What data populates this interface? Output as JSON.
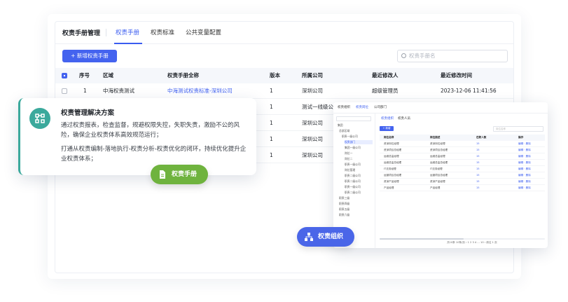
{
  "tabs": {
    "title": "权责手册管理",
    "items": [
      "权责手册",
      "权责标准",
      "公共变量配置"
    ]
  },
  "toolbar": {
    "add_label": "+ 新增权责手册",
    "search_placeholder": "权责手册名"
  },
  "table": {
    "headers": [
      "序号",
      "区域",
      "权责手册全称",
      "版本",
      "所属公司",
      "最近修改人",
      "最近修改时间"
    ],
    "rows": [
      [
        "1",
        "中海权责测试",
        "中海测试权责标准-深圳公司",
        "1",
        "深圳公司",
        "超级管理员",
        "2023-12-06 11:41:56"
      ],
      [
        "",
        "",
        "",
        "1",
        "测试一线级公",
        "",
        ""
      ],
      [
        "",
        "",
        "",
        "1",
        "深圳公司",
        "",
        ""
      ],
      [
        "",
        "",
        "",
        "1",
        "深圳公司",
        "",
        ""
      ],
      [
        "",
        "",
        "",
        "1",
        "深圳公司",
        "",
        ""
      ]
    ]
  },
  "info": {
    "title": "权责管理解决方案",
    "p1": "通过权责报表，检查监督，规避权限失控，失职失责，激励不公的风险，确保企业权责体系高效规范运行；",
    "p2": "打通从权责编制-落地执行-权责分析-权责优化的闭环，持续优化提升企业权责体系；"
  },
  "pills": {
    "manual": "权责手册",
    "org": "权责组织"
  },
  "mini": {
    "tabs": [
      "权责组织",
      "权责岗位",
      "公司部门"
    ],
    "sub_tabs": [
      "权责组织",
      "权责人员"
    ],
    "add_label": "+ 新增",
    "search_placeholder": "岗位名称",
    "tree": [
      "集团",
      "总部区域",
      "职责一级公司",
      "权责部门",
      "集团一级公司",
      "岗位一",
      "岗位二",
      "职责一级公司",
      "岗位管理",
      "职责二级公司",
      "职责二级公司",
      "职责一级公司",
      "职责二级公司",
      "职责三级",
      "职责四级",
      "职责五级",
      "职责六级"
    ],
    "headers": [
      "岗位名称",
      "岗位描述",
      "在职人数",
      "操作"
    ],
    "rows": [
      [
        "资深岗位经理",
        "资深岗位经理",
        "15",
        "编辑 · 删除"
      ],
      [
        "资深项目总经理",
        "资深项目总经理",
        "15",
        "编辑 · 删除"
      ],
      [
        "运维总监经理",
        "运维总监经理",
        "15",
        "编辑 · 删除"
      ],
      [
        "运维总监总经理",
        "运维总监总经理",
        "15",
        "编辑 · 删除"
      ],
      [
        "IT法务经理",
        "IT法务经理",
        "15",
        "编辑 · 删除"
      ],
      [
        "运营项目总经理",
        "运营项目总经理",
        "15",
        "编辑 · 删除"
      ],
      [
        "资深产品经理",
        "资深产品经理",
        "15",
        "编辑 · 删除"
      ],
      [
        "产品经理",
        "产品经理",
        "15",
        "编辑 · 删除"
      ]
    ],
    "pager": "共10条  10条/页   ‹ 1 2 3 4 … 10 ›   前往 1 页"
  },
  "colors": {
    "accent": "#4463ef",
    "teal": "#3ba99c",
    "green": "#6fb33e",
    "blue_pill": "#4a66e8"
  }
}
